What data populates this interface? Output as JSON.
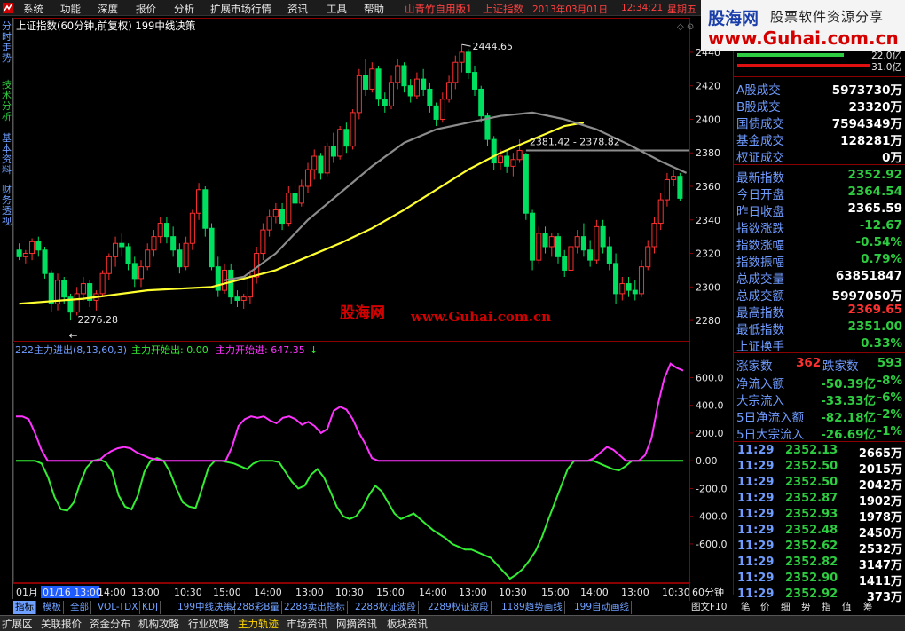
{
  "menu": {
    "items": [
      "系统",
      "功能",
      "深度",
      "报价",
      "分析",
      "扩展市场行情",
      "资讯",
      "工具",
      "帮助"
    ],
    "status": [
      "山青竹自用版1",
      "上证指数",
      "2013年03月01日",
      "12:34:21",
      "星期五"
    ]
  },
  "brand": {
    "name": "股海网",
    "slogan": "股票软件资源分享",
    "url": "www.Guhai.com.cn"
  },
  "left_tabs": [
    "分时走势",
    "技术分析",
    "基本资料",
    "财务透视"
  ],
  "main_chart": {
    "title": "上证指数(60分钟,前复权) 199中线决策",
    "high_label": "2444.65",
    "low_label": "2276.28",
    "range_label": "2381.42 - 2378.82",
    "watermark": "股海网",
    "watermark_url": "www.Guhai.com.cn"
  },
  "indicator": {
    "title": "222主力进出(8,13,60,3)",
    "s1_label": "主力开始出: 0.00",
    "s2_label": "主力开始进: 647.35",
    "colors": {
      "s1": "#33ee33",
      "s2": "#ff33ff"
    }
  },
  "x_axis": {
    "labels": [
      "01月",
      "01/16 13:00",
      "14:00",
      "13:00",
      "10:30",
      "15:00",
      "14:00",
      "13:00",
      "10:30",
      "15:00",
      "14:00",
      "13:00",
      "10:30",
      "15:00",
      "14:00",
      "13:00",
      "10:30"
    ],
    "period": "60分钟"
  },
  "chart_data": [
    {
      "type": "candlestick",
      "title": "上证指数(60分钟,前复权) 199中线决策",
      "ylim": [
        2270,
        2450
      ],
      "y_ticks": [
        2280,
        2300,
        2320,
        2340,
        2360,
        2380,
        2400,
        2420,
        2440
      ],
      "candles": [
        [
          2322,
          2326,
          2316,
          2318
        ],
        [
          2318,
          2322,
          2314,
          2320
        ],
        [
          2320,
          2329,
          2316,
          2327
        ],
        [
          2327,
          2330,
          2318,
          2322
        ],
        [
          2322,
          2324,
          2305,
          2308
        ],
        [
          2308,
          2310,
          2285,
          2290
        ],
        [
          2290,
          2308,
          2286,
          2304
        ],
        [
          2304,
          2306,
          2290,
          2294
        ],
        [
          2294,
          2296,
          2280,
          2285
        ],
        [
          2285,
          2300,
          2283,
          2296
        ],
        [
          2296,
          2306,
          2292,
          2302
        ],
        [
          2302,
          2304,
          2288,
          2292
        ],
        [
          2292,
          2298,
          2286,
          2296
        ],
        [
          2296,
          2310,
          2294,
          2308
        ],
        [
          2308,
          2320,
          2304,
          2318
        ],
        [
          2318,
          2330,
          2312,
          2326
        ],
        [
          2326,
          2332,
          2318,
          2324
        ],
        [
          2324,
          2326,
          2310,
          2314
        ],
        [
          2314,
          2318,
          2300,
          2305
        ],
        [
          2305,
          2316,
          2300,
          2312
        ],
        [
          2312,
          2326,
          2310,
          2322
        ],
        [
          2322,
          2334,
          2318,
          2330
        ],
        [
          2330,
          2342,
          2326,
          2338
        ],
        [
          2338,
          2342,
          2326,
          2330
        ],
        [
          2330,
          2336,
          2318,
          2322
        ],
        [
          2322,
          2326,
          2308,
          2312
        ],
        [
          2312,
          2330,
          2310,
          2326
        ],
        [
          2326,
          2346,
          2322,
          2344
        ],
        [
          2344,
          2362,
          2340,
          2358
        ],
        [
          2358,
          2360,
          2330,
          2335
        ],
        [
          2335,
          2338,
          2310,
          2312
        ],
        [
          2312,
          2318,
          2294,
          2298
        ],
        [
          2298,
          2314,
          2296,
          2310
        ],
        [
          2310,
          2314,
          2290,
          2294
        ],
        [
          2294,
          2298,
          2288,
          2292
        ],
        [
          2292,
          2296,
          2287,
          2294
        ],
        [
          2294,
          2310,
          2290,
          2306
        ],
        [
          2306,
          2324,
          2302,
          2320
        ],
        [
          2320,
          2338,
          2316,
          2334
        ],
        [
          2334,
          2346,
          2330,
          2342
        ],
        [
          2342,
          2350,
          2338,
          2346
        ],
        [
          2346,
          2350,
          2334,
          2338
        ],
        [
          2338,
          2360,
          2336,
          2356
        ],
        [
          2356,
          2362,
          2346,
          2350
        ],
        [
          2350,
          2364,
          2348,
          2360
        ],
        [
          2360,
          2374,
          2356,
          2370
        ],
        [
          2370,
          2382,
          2364,
          2378
        ],
        [
          2378,
          2380,
          2364,
          2368
        ],
        [
          2368,
          2386,
          2366,
          2384
        ],
        [
          2384,
          2392,
          2374,
          2378
        ],
        [
          2378,
          2396,
          2376,
          2394
        ],
        [
          2394,
          2398,
          2380,
          2384
        ],
        [
          2384,
          2406,
          2382,
          2404
        ],
        [
          2404,
          2430,
          2400,
          2426
        ],
        [
          2426,
          2436,
          2414,
          2418
        ],
        [
          2418,
          2434,
          2416,
          2430
        ],
        [
          2430,
          2432,
          2408,
          2412
        ],
        [
          2412,
          2416,
          2404,
          2408
        ],
        [
          2408,
          2426,
          2406,
          2422
        ],
        [
          2422,
          2436,
          2418,
          2432
        ],
        [
          2432,
          2434,
          2416,
          2420
        ],
        [
          2420,
          2424,
          2410,
          2414
        ],
        [
          2414,
          2428,
          2412,
          2424
        ],
        [
          2424,
          2430,
          2414,
          2418
        ],
        [
          2418,
          2422,
          2404,
          2408
        ],
        [
          2408,
          2410,
          2396,
          2400
        ],
        [
          2400,
          2416,
          2398,
          2412
        ],
        [
          2412,
          2426,
          2410,
          2422
        ],
        [
          2422,
          2438,
          2418,
          2434
        ],
        [
          2434,
          2444.65,
          2428,
          2440
        ],
        [
          2440,
          2442,
          2424,
          2428
        ],
        [
          2428,
          2432,
          2414,
          2418
        ],
        [
          2418,
          2420,
          2398,
          2402
        ],
        [
          2402,
          2404,
          2384,
          2388
        ],
        [
          2388,
          2390,
          2370,
          2374
        ],
        [
          2374,
          2382,
          2370,
          2378
        ],
        [
          2378,
          2382,
          2368,
          2372
        ],
        [
          2372,
          2380,
          2366,
          2376
        ],
        [
          2376,
          2388,
          2374,
          2381.42
        ],
        [
          2378.82,
          2380,
          2340,
          2344
        ],
        [
          2344,
          2346,
          2310,
          2316
        ],
        [
          2316,
          2336,
          2314,
          2332
        ],
        [
          2332,
          2336,
          2320,
          2324
        ],
        [
          2324,
          2332,
          2318,
          2330
        ],
        [
          2330,
          2332,
          2314,
          2318
        ],
        [
          2318,
          2322,
          2306,
          2310
        ],
        [
          2310,
          2326,
          2308,
          2324
        ],
        [
          2324,
          2334,
          2320,
          2330
        ],
        [
          2330,
          2338,
          2318,
          2322
        ],
        [
          2322,
          2328,
          2312,
          2316
        ],
        [
          2316,
          2340,
          2314,
          2336
        ],
        [
          2336,
          2340,
          2320,
          2324
        ],
        [
          2324,
          2330,
          2310,
          2314
        ],
        [
          2314,
          2320,
          2290,
          2296
        ],
        [
          2296,
          2306,
          2292,
          2302
        ],
        [
          2302,
          2306,
          2294,
          2298
        ],
        [
          2298,
          2304,
          2292,
          2296
        ],
        [
          2296,
          2316,
          2294,
          2312
        ],
        [
          2312,
          2328,
          2310,
          2324
        ],
        [
          2324,
          2342,
          2320,
          2338
        ],
        [
          2338,
          2356,
          2334,
          2352
        ],
        [
          2352,
          2368,
          2348,
          2364
        ],
        [
          2364,
          2369.65,
          2360,
          2366
        ],
        [
          2366,
          2368,
          2351,
          2352.92
        ]
      ],
      "ma_yellow": [
        [
          0,
          2290
        ],
        [
          10,
          2293
        ],
        [
          20,
          2298
        ],
        [
          30,
          2300
        ],
        [
          35,
          2305
        ],
        [
          40,
          2310
        ],
        [
          45,
          2318
        ],
        [
          50,
          2326
        ],
        [
          55,
          2335
        ],
        [
          60,
          2346
        ],
        [
          65,
          2358
        ],
        [
          70,
          2370
        ],
        [
          75,
          2380
        ],
        [
          80,
          2388
        ],
        [
          85,
          2396
        ],
        [
          88,
          2398
        ]
      ],
      "ma_grey": [
        [
          32,
          2304
        ],
        [
          35,
          2306
        ],
        [
          40,
          2320
        ],
        [
          45,
          2340
        ],
        [
          50,
          2356
        ],
        [
          55,
          2372
        ],
        [
          60,
          2386
        ],
        [
          65,
          2394
        ],
        [
          70,
          2398
        ],
        [
          75,
          2402
        ],
        [
          80,
          2404
        ],
        [
          85,
          2400
        ],
        [
          90,
          2394
        ],
        [
          95,
          2385
        ],
        [
          100,
          2375
        ],
        [
          104,
          2368
        ]
      ],
      "annotations": {
        "high": 2444.65,
        "low": 2276.28,
        "range": [
          "2381.42",
          "2378.82"
        ]
      }
    },
    {
      "type": "line",
      "title": "222主力进出(8,13,60,3)",
      "ylim": [
        -850,
        750
      ],
      "y_ticks": [
        -600,
        -400,
        -200,
        0,
        200,
        400,
        600
      ],
      "tick_labels": [
        "-600.0",
        "-400.0",
        "-200.0",
        "0.00",
        "200.0",
        "400.0",
        "600.0"
      ],
      "series": [
        {
          "name": "主力开始出",
          "color": "#33ee33",
          "values": [
            0,
            0,
            0,
            0,
            -20,
            -120,
            -260,
            -350,
            -360,
            -300,
            -160,
            -50,
            0,
            10,
            -10,
            -80,
            -250,
            -330,
            -350,
            -250,
            -80,
            0,
            20,
            0,
            -80,
            -200,
            -300,
            -330,
            -340,
            -200,
            -50,
            0,
            0,
            -10,
            -20,
            -40,
            -60,
            -20,
            0,
            0,
            0,
            -10,
            -80,
            -150,
            -200,
            -180,
            -100,
            -60,
            -120,
            -220,
            -330,
            -400,
            -420,
            -400,
            -340,
            -250,
            -180,
            -220,
            -300,
            -380,
            -420,
            -400,
            -380,
            -420,
            -460,
            -500,
            -530,
            -560,
            -600,
            -620,
            -640,
            -640,
            -660,
            -680,
            -700,
            -750,
            -800,
            -850,
            -820,
            -780,
            -720,
            -650,
            -550,
            -420,
            -300,
            -180,
            -60,
            0,
            0,
            0,
            0,
            -20,
            -40,
            -60,
            -70,
            -40,
            0,
            0,
            0,
            0,
            0,
            0,
            0,
            0,
            0
          ]
        },
        {
          "name": "主力开始进",
          "color": "#ff33ff",
          "values": [
            320,
            320,
            300,
            200,
            80,
            0,
            0,
            0,
            0,
            0,
            0,
            0,
            0,
            0,
            40,
            70,
            90,
            100,
            90,
            60,
            40,
            20,
            10,
            0,
            0,
            0,
            0,
            0,
            0,
            0,
            0,
            0,
            0,
            0,
            100,
            250,
            300,
            320,
            310,
            320,
            290,
            270,
            310,
            320,
            300,
            260,
            280,
            250,
            200,
            230,
            360,
            390,
            370,
            300,
            200,
            120,
            20,
            0,
            0,
            0,
            0,
            0,
            0,
            0,
            0,
            0,
            0,
            0,
            0,
            0,
            0,
            0,
            0,
            0,
            0,
            0,
            0,
            0,
            0,
            0,
            0,
            0,
            0,
            0,
            0,
            0,
            0,
            0,
            0,
            0,
            0,
            20,
            60,
            100,
            80,
            40,
            0,
            0,
            0,
            40,
            160,
            400,
            590,
            700,
            670,
            650
          ]
        }
      ]
    }
  ],
  "right_panel": {
    "volume_bars": {
      "red": 0.55,
      "green": 0.45,
      "label_up": "22.0亿",
      "label_down": "31.0亿"
    },
    "turnover": [
      {
        "label": "A股成交",
        "value": "5973730万",
        "color": "#ffffff"
      },
      {
        "label": "B股成交",
        "value": "23320万",
        "color": "#ffffff"
      },
      {
        "label": "国债成交",
        "value": "7594349万",
        "color": "#ffffff"
      },
      {
        "label": "基金成交",
        "value": "128281万",
        "color": "#ffffff"
      },
      {
        "label": "权证成交",
        "value": "0万",
        "color": "#ffffff"
      }
    ],
    "quote": [
      {
        "label": "最新指数",
        "value": "2352.92",
        "color": "#2ecc40"
      },
      {
        "label": "今日开盘",
        "value": "2364.54",
        "color": "#2ecc40"
      },
      {
        "label": "昨日收盘",
        "value": "2365.59",
        "color": "#ffffff"
      },
      {
        "label": "指数涨跌",
        "value": "-12.67",
        "color": "#2ecc40"
      },
      {
        "label": "指数涨幅",
        "value": "-0.54%",
        "color": "#2ecc40"
      },
      {
        "label": "指数振幅",
        "value": "0.79%",
        "color": "#2ecc40"
      },
      {
        "label": "总成交量",
        "value": "63851847",
        "color": "#ffffff"
      },
      {
        "label": "总成交额",
        "value": "5997050万",
        "color": "#ffffff"
      },
      {
        "label": "最高指数",
        "value": "2369.65",
        "color": "#ff3030"
      },
      {
        "label": "最低指数",
        "value": "2351.00",
        "color": "#2ecc40"
      },
      {
        "label": "上证换手",
        "value": "0.33%",
        "color": "#2ecc40"
      }
    ],
    "breadth": {
      "up_label": "涨家数",
      "up": "362",
      "down_label": "跌家数",
      "down": "593"
    },
    "flows": [
      {
        "label": "净流入额",
        "value": "-50.39亿",
        "pct": "-8%"
      },
      {
        "label": "大宗流入",
        "value": "-33.33亿",
        "pct": "-6%"
      },
      {
        "label": "5日净流入额",
        "value": "-82.18亿",
        "pct": "-2%"
      },
      {
        "label": "5日大宗流入",
        "value": "-26.69亿",
        "pct": "-1%"
      }
    ],
    "ticks": [
      {
        "t": "11:29",
        "p": "2352.13",
        "v": "2665万"
      },
      {
        "t": "11:29",
        "p": "2352.50",
        "v": "2015万"
      },
      {
        "t": "11:29",
        "p": "2352.50",
        "v": "2042万"
      },
      {
        "t": "11:29",
        "p": "2352.87",
        "v": "1902万"
      },
      {
        "t": "11:29",
        "p": "2352.93",
        "v": "1978万"
      },
      {
        "t": "11:29",
        "p": "2352.48",
        "v": "2450万"
      },
      {
        "t": "11:29",
        "p": "2352.62",
        "v": "2532万"
      },
      {
        "t": "11:29",
        "p": "2352.82",
        "v": "3147万"
      },
      {
        "t": "11:29",
        "p": "2352.90",
        "v": "1411万"
      },
      {
        "t": "11:29",
        "p": "2352.92",
        "v": "373万"
      }
    ]
  },
  "bottom_tabs": [
    "指标",
    "模板",
    "全部",
    "VOL-TDX",
    "KDJ",
    "199中线决策",
    "2288彩B量",
    "2288卖出指标",
    "2288权证波段",
    "2289权证波段",
    "1189趋势画线",
    "199自动画线"
  ],
  "right_bottom_tabs": [
    "图文F10",
    "笔",
    "价",
    "细",
    "势",
    "指",
    "值",
    "筹"
  ],
  "bottom_bar": [
    "扩展区",
    "关联报价",
    "资金分布",
    "机构攻略",
    "行业攻略",
    "主力轨迹",
    "市场资讯",
    "网摘资讯",
    "板块资讯"
  ]
}
